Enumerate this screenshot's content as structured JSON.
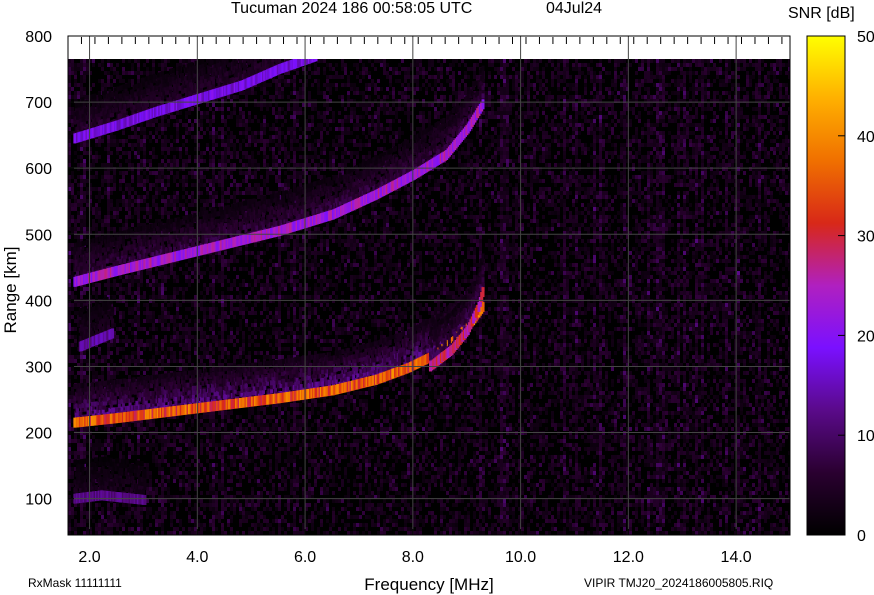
{
  "chart_data": {
    "type": "heatmap",
    "title": "Tucuman 2024 186 00:58:05 UTC",
    "date": "04Jul24",
    "xlabel": "Frequency [MHz]",
    "ylabel": "Range [km]",
    "xlim": [
      1.6,
      15.0
    ],
    "ylim": [
      45,
      800
    ],
    "xticks": [
      2.0,
      4.0,
      6.0,
      8.0,
      10.0,
      12.0,
      14.0
    ],
    "xtick_labels": [
      "2.0",
      "4.0",
      "6.0",
      "8.0",
      "10.0",
      "12.0",
      "14.0"
    ],
    "yticks": [
      100,
      200,
      300,
      400,
      500,
      600,
      700,
      800
    ],
    "ytick_labels": [
      "100",
      "200",
      "300",
      "400",
      "500",
      "600",
      "700",
      "800"
    ],
    "colorbar": {
      "label": "SNR [dB]",
      "range": [
        0,
        50
      ],
      "ticks": [
        0,
        10,
        20,
        30,
        40,
        50
      ],
      "tick_labels": [
        "0",
        "10",
        "20",
        "30",
        "40",
        "50"
      ],
      "colors": [
        "#000000",
        "#2a0030",
        "#5a0a8a",
        "#7a10ff",
        "#b020c0",
        "#d82818",
        "#f07000",
        "#ffb000",
        "#ffff00"
      ]
    },
    "grid": true,
    "traces": [
      {
        "name": "",
        "points": [
          [
            1.7,
            215
          ],
          [
            2.5,
            222
          ],
          [
            3.5,
            232
          ],
          [
            4.5,
            242
          ],
          [
            5.5,
            252
          ],
          [
            6.5,
            264
          ],
          [
            7.3,
            280
          ],
          [
            7.9,
            298
          ],
          [
            8.4,
            318
          ],
          [
            8.8,
            345
          ],
          [
            9.1,
            370
          ],
          [
            9.3,
            393
          ]
        ],
        "snr": 36
      },
      {
        "name": "",
        "points": [
          [
            8.3,
            300
          ],
          [
            8.7,
            325
          ],
          [
            9.0,
            355
          ],
          [
            9.2,
            390
          ],
          [
            9.3,
            420
          ]
        ],
        "snr": 28
      },
      {
        "name": "",
        "points": [
          [
            1.7,
            428
          ],
          [
            2.5,
            445
          ],
          [
            3.5,
            465
          ],
          [
            4.5,
            485
          ],
          [
            5.5,
            505
          ],
          [
            6.5,
            530
          ],
          [
            7.3,
            560
          ],
          [
            8.0,
            590
          ],
          [
            8.6,
            620
          ],
          [
            9.0,
            660
          ],
          [
            9.3,
            700
          ]
        ],
        "snr": 24
      },
      {
        "name": "",
        "points": [
          [
            1.7,
            645
          ],
          [
            2.5,
            665
          ],
          [
            3.2,
            685
          ],
          [
            4.0,
            705
          ],
          [
            4.8,
            725
          ],
          [
            5.5,
            750
          ],
          [
            6.2,
            770
          ]
        ],
        "snr": 18
      },
      {
        "name": "",
        "points": [
          [
            1.8,
            330
          ],
          [
            2.4,
            350
          ]
        ],
        "snr": 14
      },
      {
        "name": "",
        "points": [
          [
            1.7,
            100
          ],
          [
            2.2,
            105
          ],
          [
            3.0,
            98
          ]
        ],
        "snr": 12
      }
    ]
  },
  "footer": {
    "rxmask": "RxMask 11111111",
    "instrument": "VIPIR  TMJ20_2024186005805.RIQ"
  }
}
